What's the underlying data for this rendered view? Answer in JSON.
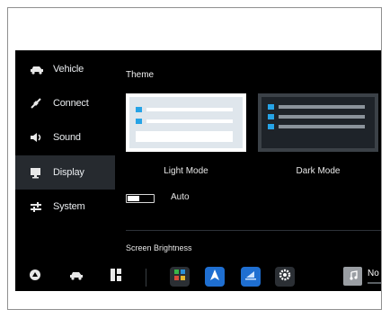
{
  "sidebar": {
    "items": [
      {
        "label": "Vehicle",
        "icon": "car-icon"
      },
      {
        "label": "Connect",
        "icon": "connect-icon"
      },
      {
        "label": "Sound",
        "icon": "speaker-icon"
      },
      {
        "label": "Display",
        "icon": "monitor-icon",
        "active": true
      },
      {
        "label": "System",
        "icon": "sliders-icon"
      }
    ]
  },
  "display": {
    "theme_title": "Theme",
    "light_mode_label": "Light Mode",
    "dark_mode_label": "Dark Mode",
    "auto_label": "Auto",
    "brightness_label": "Screen Brightness"
  },
  "dock": {
    "buttons": [
      "home-circle-icon",
      "car-icon",
      "split-view-icon"
    ],
    "apps": [
      "tiles-app-icon",
      "navigation-app-icon",
      "chart-app-icon",
      "settings-app-icon"
    ],
    "media_text": "No con"
  },
  "colors": {
    "screen_bg": "#000000",
    "sidebar_active": "#262a2f",
    "accent_blue": "#26a3e6",
    "nav_blue": "#1f6fd1"
  }
}
